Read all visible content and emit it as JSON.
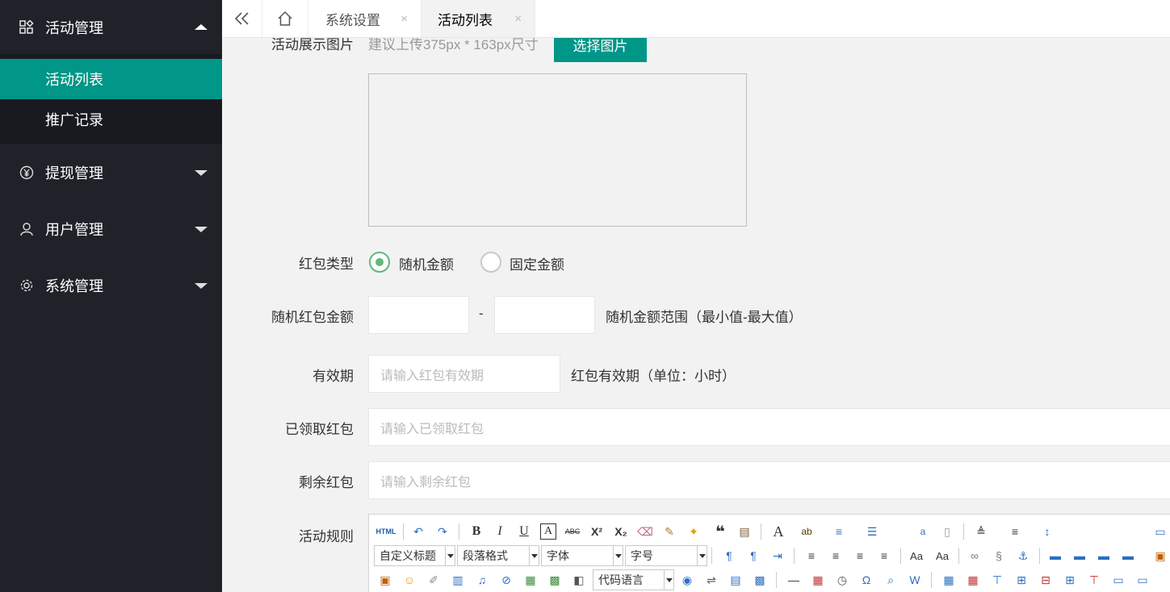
{
  "sidebar": {
    "groups": [
      {
        "label": "活动管理",
        "icon": "grid-icon",
        "expanded": true
      },
      {
        "label": "提现管理",
        "icon": "yen-icon",
        "expanded": false
      },
      {
        "label": "用户管理",
        "icon": "user-icon",
        "expanded": false
      },
      {
        "label": "系统管理",
        "icon": "gear-icon",
        "expanded": false
      }
    ],
    "subitems": [
      {
        "label": "活动列表",
        "active": true
      },
      {
        "label": "推广记录",
        "active": false
      }
    ]
  },
  "topbar": {
    "tabs": [
      {
        "label": "系统设置",
        "active": false
      },
      {
        "label": "活动列表",
        "active": true
      }
    ],
    "close_glyph": "×"
  },
  "form": {
    "image": {
      "label": "活动展示图片",
      "hint": "建议上传375px * 163px尺寸",
      "button": "选择图片"
    },
    "redpack_type": {
      "label": "红包类型",
      "options": [
        {
          "label": "随机金额",
          "checked": true
        },
        {
          "label": "固定金额",
          "checked": false
        }
      ]
    },
    "random_amount": {
      "label": "随机红包金额",
      "dash": "-",
      "hint": "随机金额范围（最小值-最大值）"
    },
    "validity": {
      "label": "有效期",
      "placeholder": "请输入红包有效期",
      "hint": "红包有效期（单位：小时）"
    },
    "received": {
      "label": "已领取红包",
      "placeholder": "请输入已领取红包"
    },
    "remaining": {
      "label": "剩余红包",
      "placeholder": "请输入剩余红包"
    },
    "rules": {
      "label": "活动规则"
    }
  },
  "editor": {
    "html_label": "HTML",
    "selects": [
      "自定义标题",
      "段落格式",
      "字体",
      "字号",
      "代码语言"
    ],
    "colors": {
      "accent": "#009688",
      "radio": "#5fb878",
      "sidebar": "#20222a"
    }
  }
}
